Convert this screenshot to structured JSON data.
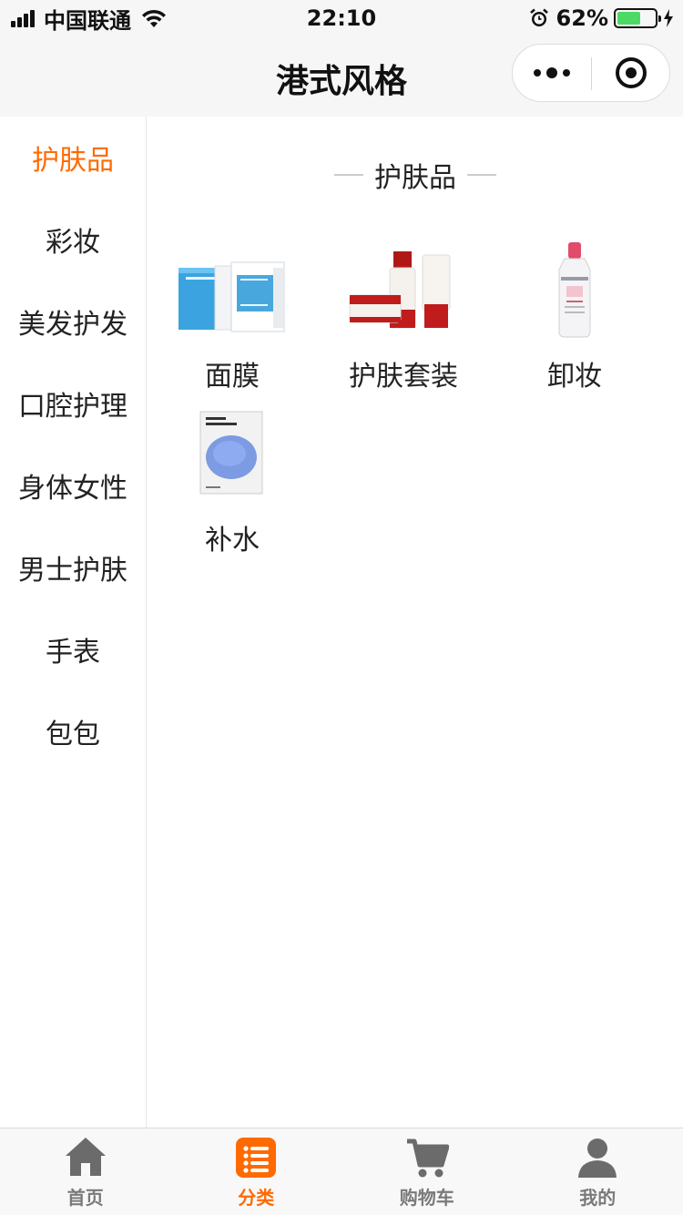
{
  "status_bar": {
    "carrier": "中国联通",
    "time": "22:10",
    "battery_percent": "62%",
    "battery_level": 0.62
  },
  "nav": {
    "title": "港式风格",
    "more_icon": "more-dots-icon",
    "close_icon": "target-close-icon"
  },
  "sidebar": {
    "active_index": 0,
    "active_color": "#ff6a00",
    "items": [
      {
        "label": "护肤品"
      },
      {
        "label": "彩妆"
      },
      {
        "label": "美发护发"
      },
      {
        "label": "口腔护理"
      },
      {
        "label": "身体女性"
      },
      {
        "label": "男士护肤"
      },
      {
        "label": "手表"
      },
      {
        "label": "包包"
      }
    ]
  },
  "content": {
    "section_title": "护肤品",
    "items": [
      {
        "label": "面膜",
        "image": "facial-mask-boxes"
      },
      {
        "label": "护肤套装",
        "image": "skincare-set-bottles"
      },
      {
        "label": "卸妆",
        "image": "micellar-water-bottle"
      },
      {
        "label": "补水",
        "image": "hydra-sheet-mask"
      }
    ]
  },
  "tab_bar": {
    "active_index": 1,
    "tabs": [
      {
        "label": "首页",
        "icon": "home-icon"
      },
      {
        "label": "分类",
        "icon": "category-list-icon"
      },
      {
        "label": "购物车",
        "icon": "cart-icon"
      },
      {
        "label": "我的",
        "icon": "user-icon"
      }
    ]
  }
}
